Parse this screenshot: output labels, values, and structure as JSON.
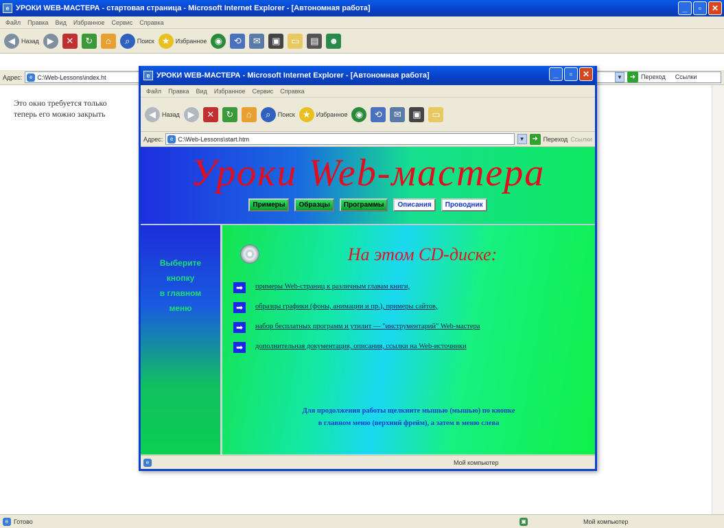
{
  "outer": {
    "title": "УРОКИ WEB-МАСТЕРА - стартовая страница - Microsoft Internet Explorer - [Автономная работа]",
    "menu": [
      "Файл",
      "Правка",
      "Вид",
      "Избранное",
      "Сервис",
      "Справка"
    ],
    "toolbar": {
      "back": "Назад",
      "search": "Поиск",
      "favorites": "Избранное"
    },
    "address": {
      "label": "Адрес:",
      "value": "C:\\Web-Lessons\\index.ht",
      "go": "Переход",
      "links": "Ссылки"
    },
    "content_lines": [
      "Это окно требуется только",
      "теперь его можно закрыть"
    ],
    "status": {
      "left": "Готово",
      "right": "Мой компьютер"
    }
  },
  "inner": {
    "title": "УРОКИ WEB-МАСТЕРА - Microsoft Internet Explorer - [Автономная работа]",
    "menu": [
      "Файл",
      "Правка",
      "Вид",
      "Избранное",
      "Сервис",
      "Справка"
    ],
    "toolbar": {
      "back": "Назад",
      "search": "Поиск",
      "favorites": "Избранное"
    },
    "address": {
      "label": "Адрес:",
      "value": "C:\\Web-Lessons\\start.htm",
      "go": "Переход",
      "links": "Ссылки"
    },
    "status": {
      "right": "Мой компьютер"
    },
    "page": {
      "banner_title": "Уроки  Web-мастера",
      "nav": [
        "Примеры",
        "Образцы",
        "Программы",
        "Описания",
        "Проводник"
      ],
      "left_text": [
        "Выберите",
        "кнопку",
        "в главном",
        "меню"
      ],
      "heading": "На этом CD-диске:",
      "links": [
        "примеры Web-страниц к различным главам книги,",
        "образцы графики (фоны, анимации и пр.), примеры сайтов,",
        "набор бесплатных программ и утилит — \"инструментарий\" Web-мастера",
        "дополнительная документация, описания, ссылки на Web-источники"
      ],
      "note": [
        "Для продолжения работы щелкните мышью (мышью) по кнопке",
        "в главном меню (верхний фрейм), а затем в меню слева"
      ]
    }
  }
}
